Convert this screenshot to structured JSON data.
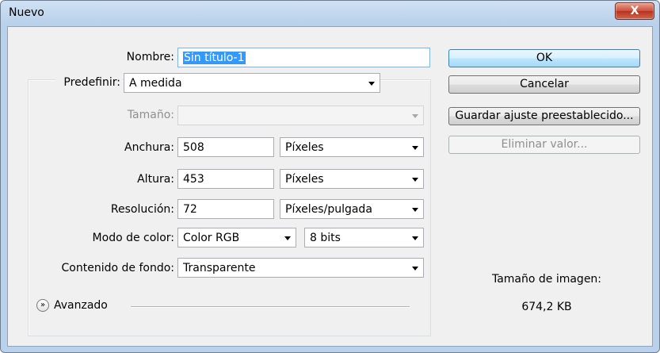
{
  "window": {
    "title": "Nuevo",
    "close_symbol": "X"
  },
  "form": {
    "nombre_label": "Nombre:",
    "nombre_value": "Sin título-1",
    "predefinir_label": "Predefinir:",
    "predefinir_value": "A medida",
    "tamano_label": "Tamaño:",
    "tamano_value": "",
    "anchura_label": "Anchura:",
    "anchura_value": "508",
    "anchura_unit": "Píxeles",
    "altura_label": "Altura:",
    "altura_value": "453",
    "altura_unit": "Píxeles",
    "resolucion_label": "Resolución:",
    "resolucion_value": "72",
    "resolucion_unit": "Píxeles/pulgada",
    "modo_label": "Modo de color:",
    "modo_value": "Color RGB",
    "bits_value": "8 bits",
    "fondo_label": "Contenido de fondo:",
    "fondo_value": "Transparente",
    "avanzado_label": "Avanzado",
    "avanzado_icon": "expand-chevrons-icon"
  },
  "buttons": {
    "ok": "OK",
    "cancelar": "Cancelar",
    "guardar": "Guardar ajuste preestablecido...",
    "eliminar": "Eliminar valor..."
  },
  "info": {
    "size_label": "Tamaño de imagen:",
    "size_value": "674,2 KB"
  }
}
